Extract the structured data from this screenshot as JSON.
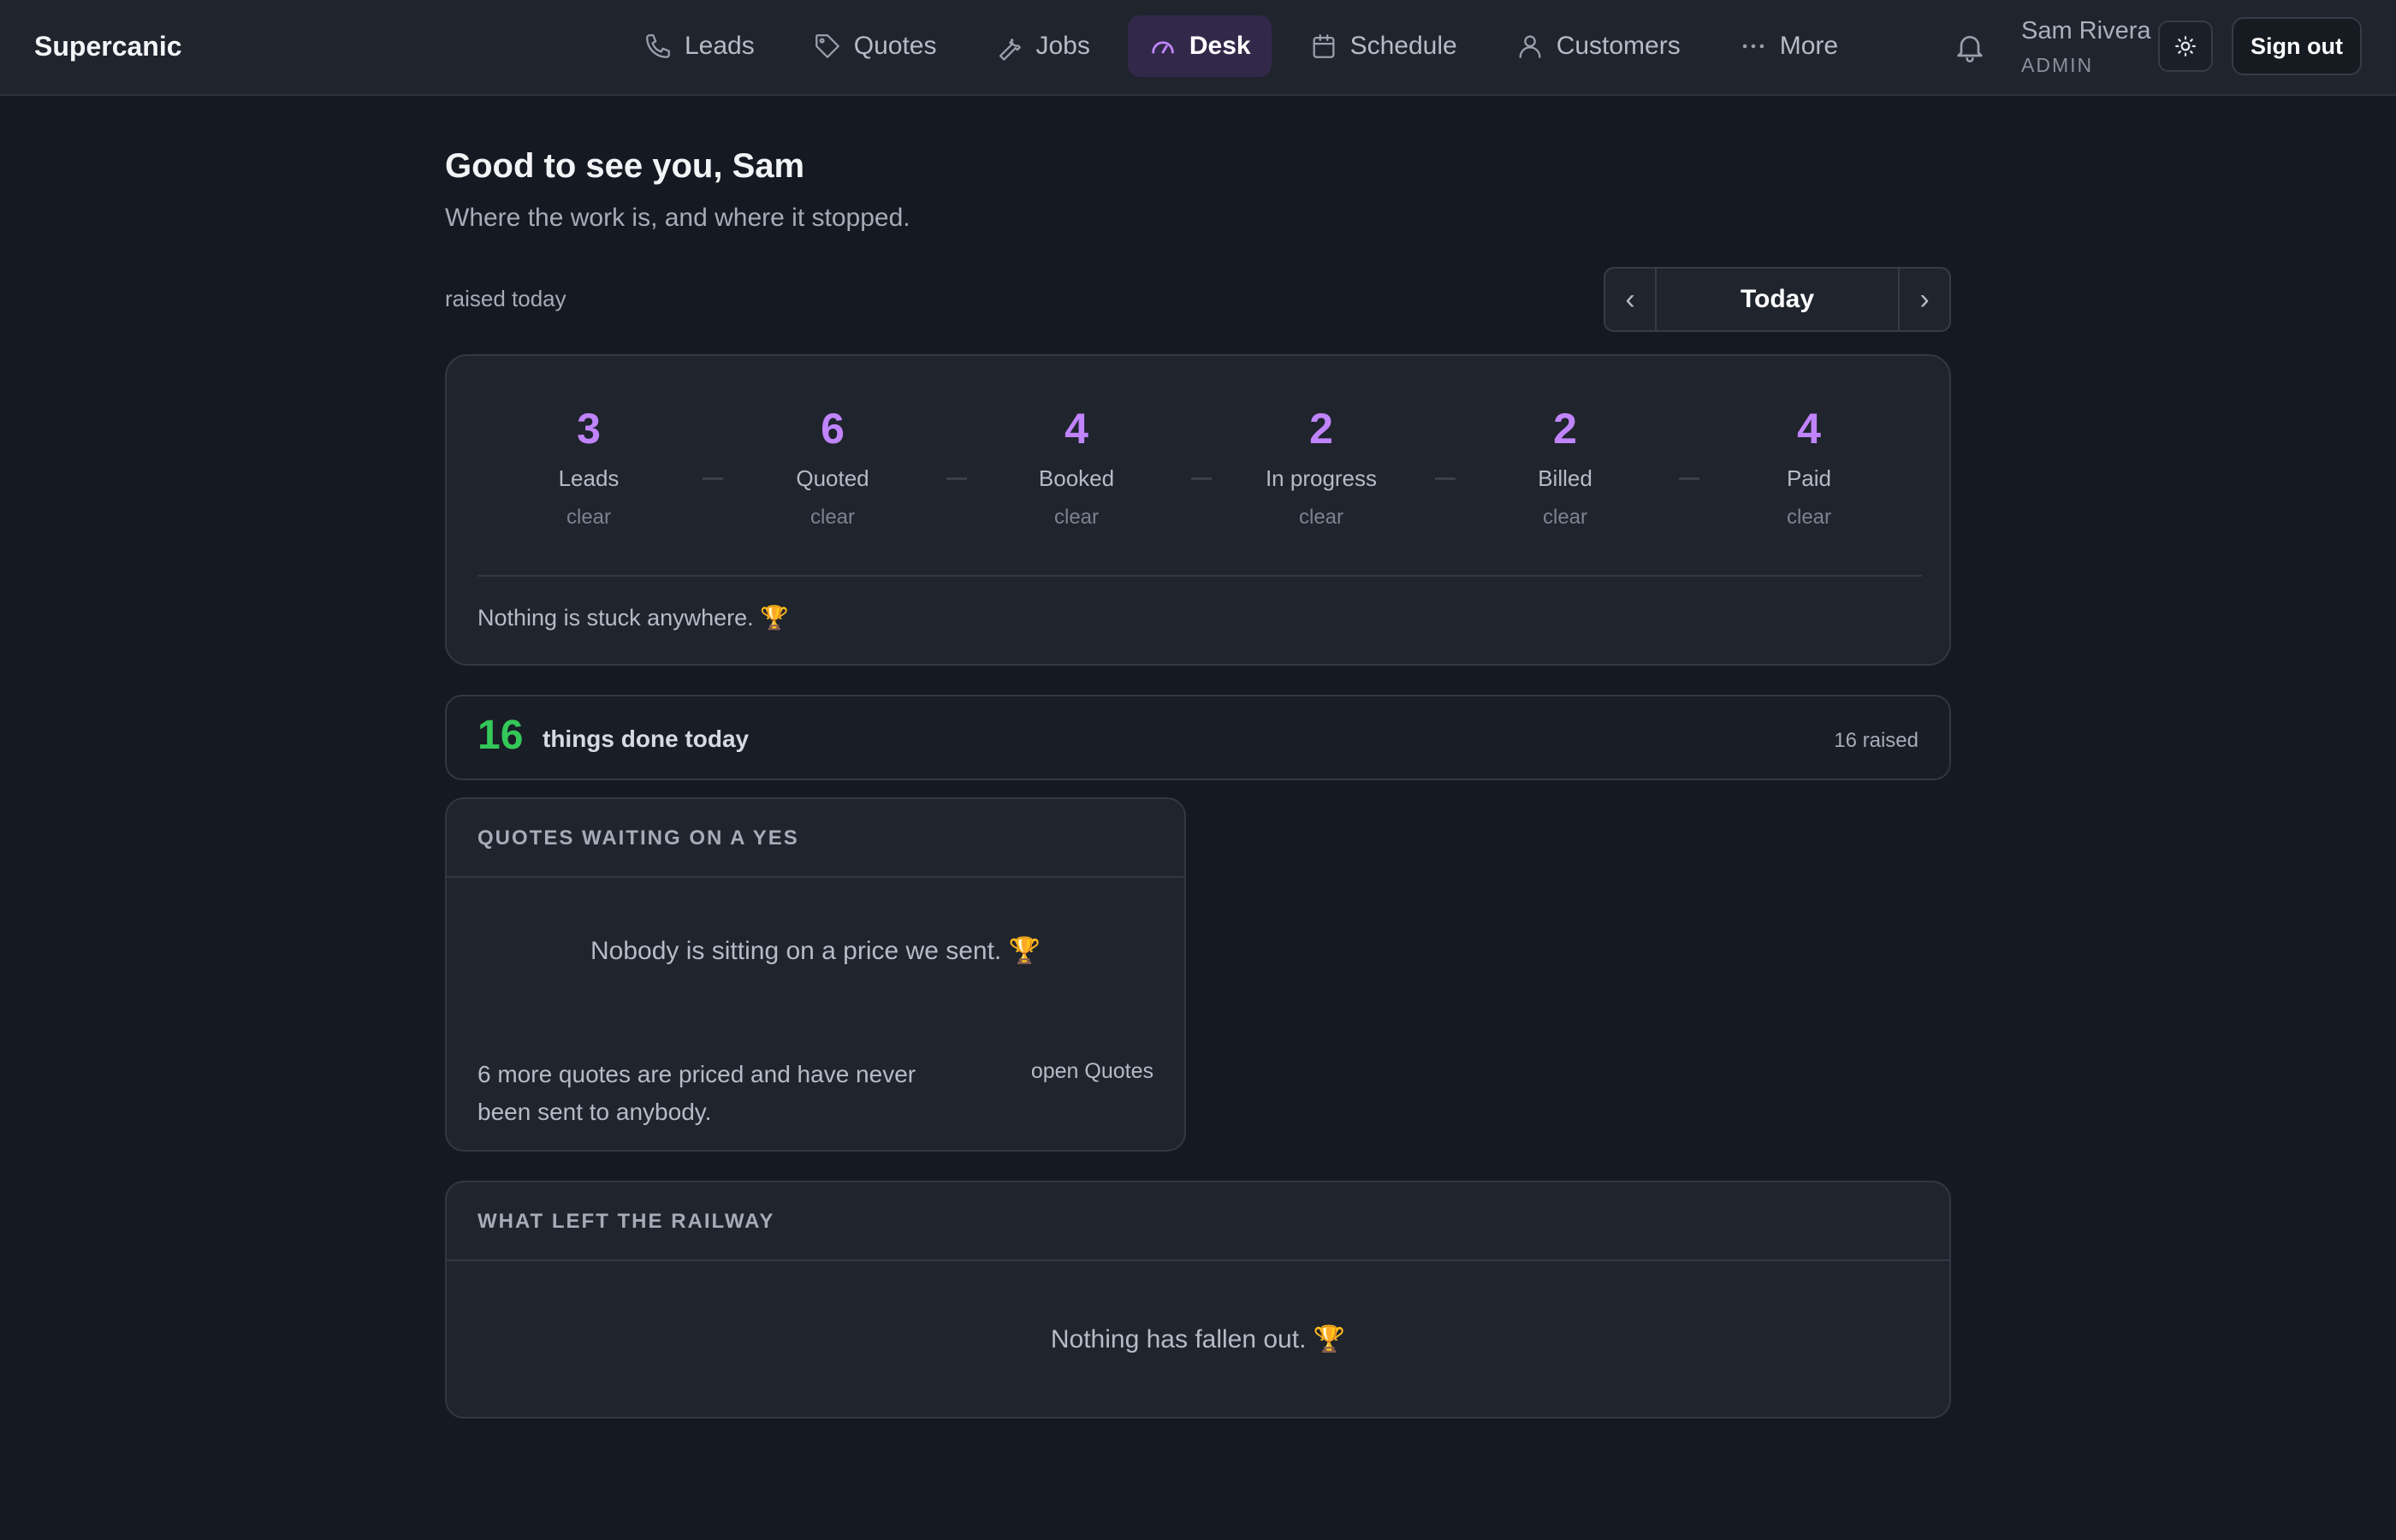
{
  "app": {
    "brand": "Supercanic"
  },
  "nav": {
    "items": [
      {
        "label": "Leads",
        "icon": "phone-icon"
      },
      {
        "label": "Quotes",
        "icon": "tag-icon"
      },
      {
        "label": "Jobs",
        "icon": "wrench-icon"
      },
      {
        "label": "Desk",
        "icon": "gauge-icon",
        "active": true
      },
      {
        "label": "Schedule",
        "icon": "calendar-icon"
      },
      {
        "label": "Customers",
        "icon": "user-icon"
      },
      {
        "label": "More",
        "icon": "more-dots-icon"
      }
    ]
  },
  "user": {
    "name": "Sam Rivera",
    "role": "ADMIN",
    "sign_out": "Sign out"
  },
  "header": {
    "greeting": "Good to see you, Sam",
    "subtitle": "Where the work is, and where it stopped."
  },
  "filter": {
    "raised_label": "raised today",
    "date_label": "Today"
  },
  "pipeline": {
    "stages": [
      {
        "count": "3",
        "name": "Leads",
        "status": "clear"
      },
      {
        "count": "6",
        "name": "Quoted",
        "status": "clear"
      },
      {
        "count": "4",
        "name": "Booked",
        "status": "clear"
      },
      {
        "count": "2",
        "name": "In progress",
        "status": "clear"
      },
      {
        "count": "2",
        "name": "Billed",
        "status": "clear"
      },
      {
        "count": "4",
        "name": "Paid",
        "status": "clear"
      }
    ],
    "footer": "Nothing is stuck anywhere.",
    "footer_emoji": "🏆"
  },
  "done": {
    "count": "16",
    "label": "things done today",
    "raised": "16 raised"
  },
  "quotes_waiting": {
    "title": "QUOTES WAITING ON A YES",
    "empty": "Nobody is sitting on a price we sent.",
    "empty_emoji": "🏆",
    "note": "6 more quotes are priced and have never been sent to anybody.",
    "link": "open Quotes"
  },
  "railway": {
    "title": "WHAT LEFT THE RAILWAY",
    "empty": "Nothing has fallen out.",
    "empty_emoji": "🏆"
  },
  "colors": {
    "accent": "#c084fc",
    "success": "#34c759",
    "active_nav_bg": "#32294a",
    "background": "#151921"
  }
}
